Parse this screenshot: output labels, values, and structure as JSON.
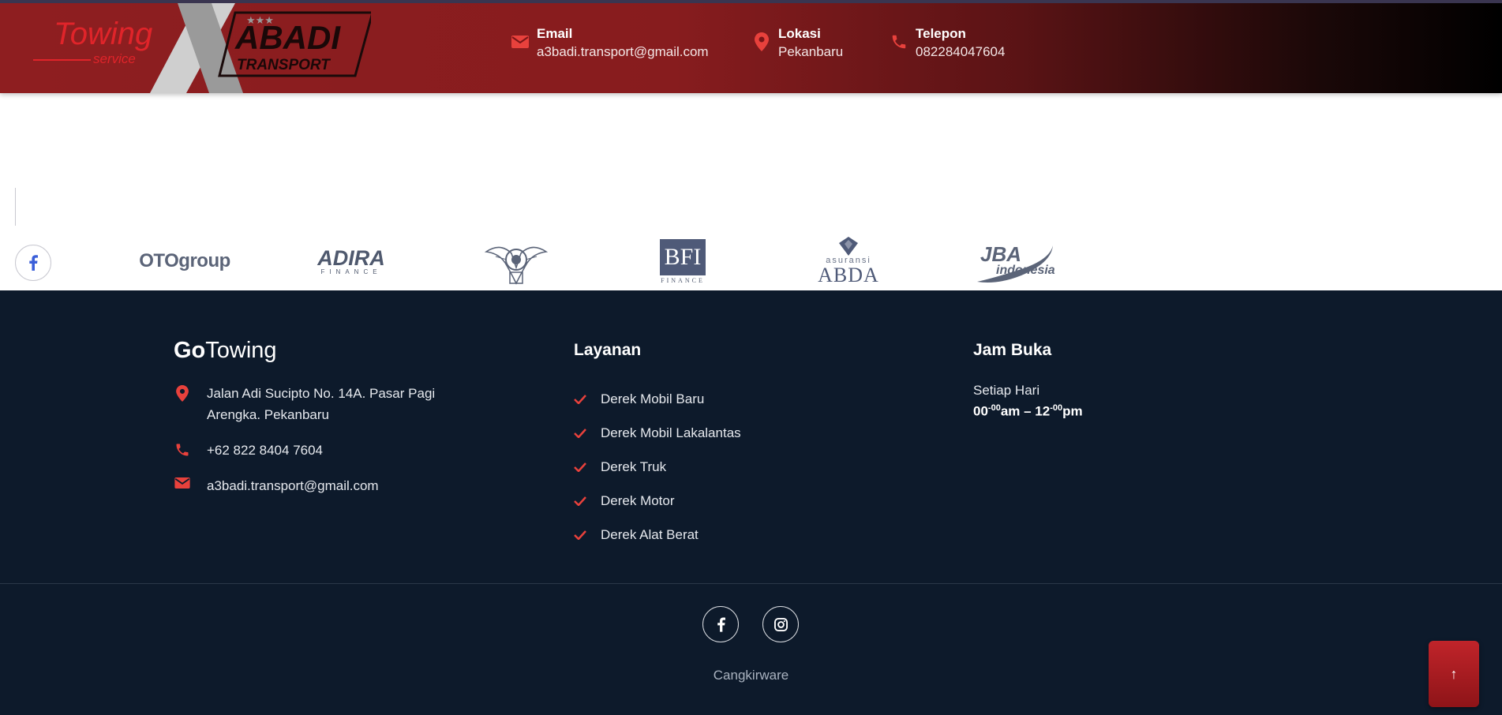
{
  "header": {
    "logo": {
      "word1": "Towing",
      "word2": "service",
      "letter": "X",
      "word3": "ABADI",
      "word4": "TRANSPORT"
    },
    "contacts": [
      {
        "icon": "envelope-icon",
        "label": "Email",
        "value": "a3badi.transport@gmail.com"
      },
      {
        "icon": "map-pin-icon",
        "label": "Lokasi",
        "value": "Pekanbaru"
      },
      {
        "icon": "phone-icon",
        "label": "Telepon",
        "value": "082284047604"
      }
    ]
  },
  "left_social": [
    {
      "icon": "facebook-icon",
      "color": "#3b5fd9"
    },
    {
      "icon": "telegram-icon",
      "color": "#5c8fe0"
    },
    {
      "icon": "instagram-icon",
      "color": "#e0445a"
    }
  ],
  "partners": [
    {
      "name": "OTOgroup"
    },
    {
      "name": "ADIRA",
      "sub": "FINANCE"
    },
    {
      "name": "emblem"
    },
    {
      "name": "BFI",
      "sub": "FINANCE"
    },
    {
      "name": "ABDA",
      "pre": "asuransi"
    },
    {
      "name": "JBA",
      "sub": "indonesia"
    }
  ],
  "footer": {
    "brand_bold": "Go",
    "brand_light": "Towing",
    "address": "Jalan Adi Sucipto No. 14A. Pasar Pagi Arengka. Pekanbaru",
    "phone": "+62 822 8404 7604",
    "email": "a3badi.transport@gmail.com",
    "services_title": "Layanan",
    "services": [
      "Derek Mobil Baru",
      "Derek Mobil Lakalantas",
      "Derek Truk",
      "Derek Motor",
      "Derek Alat Berat"
    ],
    "hours_title": "Jam Buka",
    "hours_label": "Setiap Hari",
    "hours_start": "00",
    "hours_start_sup": "-00",
    "hours_mid": "am – 12",
    "hours_end_sup": "-00",
    "hours_end": "pm",
    "credit": "Cangkirware"
  },
  "back_to_top": "↑",
  "colors": {
    "accent": "#e8413c",
    "footer_bg": "#0d1a2b",
    "header_red": "#8e1e20"
  }
}
